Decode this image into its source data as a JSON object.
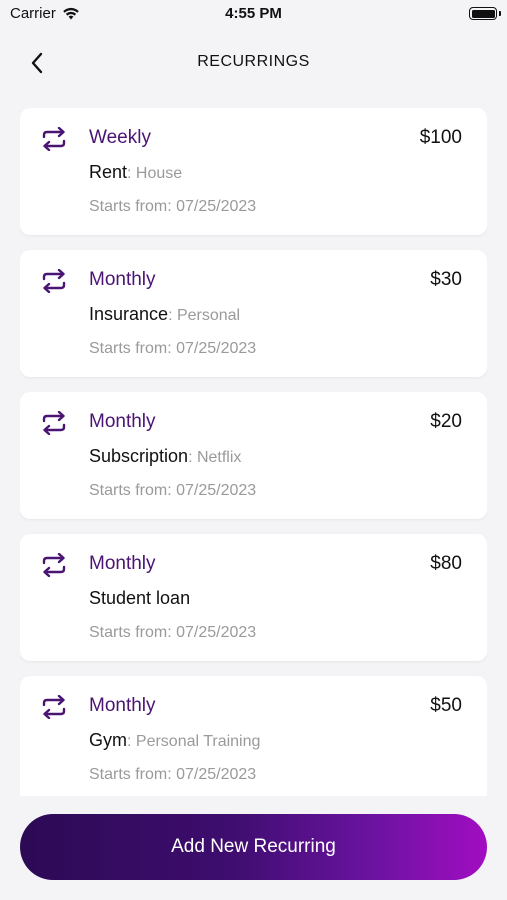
{
  "status_bar": {
    "carrier": "Carrier",
    "time": "4:55 PM",
    "wifi_icon": "wifi-icon",
    "battery_icon": "battery-icon"
  },
  "header": {
    "back_icon": "chevron-left-icon",
    "title": "RECURRINGS"
  },
  "colors": {
    "accent": "#4a1473",
    "background": "#f4f4f7",
    "card": "#ffffff",
    "muted": "#9a9a9a",
    "button_gradient_start": "#2c0a55",
    "button_gradient_end": "#a20dc2"
  },
  "recurrings": [
    {
      "frequency": "Weekly",
      "amount": "$100",
      "name": "Rent",
      "category": ": House",
      "starts": "Starts from: 07/25/2023"
    },
    {
      "frequency": "Monthly",
      "amount": "$30",
      "name": "Insurance",
      "category": ": Personal",
      "starts": "Starts from: 07/25/2023"
    },
    {
      "frequency": "Monthly",
      "amount": "$20",
      "name": "Subscription",
      "category": ": Netflix",
      "starts": "Starts from: 07/25/2023"
    },
    {
      "frequency": "Monthly",
      "amount": "$80",
      "name": "Student loan",
      "category": "",
      "starts": "Starts from: 07/25/2023"
    },
    {
      "frequency": "Monthly",
      "amount": "$50",
      "name": "Gym",
      "category": ": Personal Training",
      "starts": "Starts from: 07/25/2023"
    }
  ],
  "add_button": {
    "label": "Add New Recurring"
  }
}
